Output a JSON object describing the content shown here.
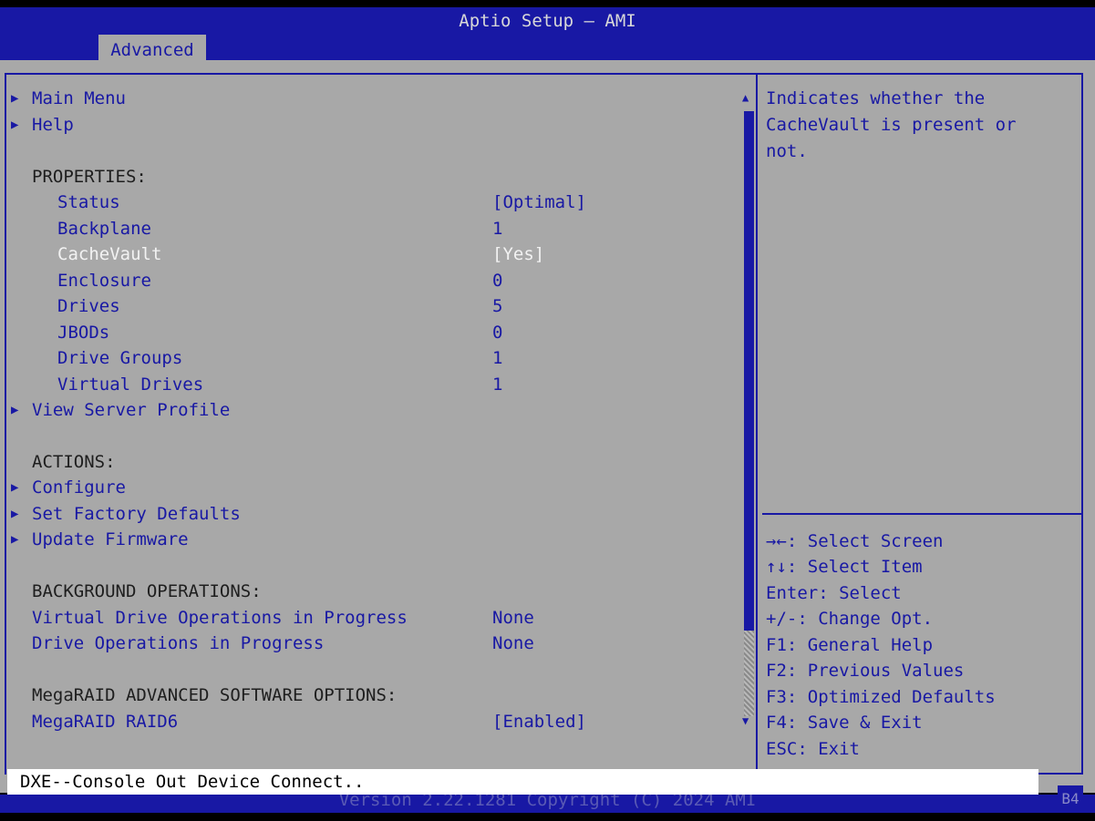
{
  "window": {
    "title": "Aptio Setup – AMI",
    "active_tab": "Advanced"
  },
  "menu": {
    "main_menu": "Main Menu",
    "help": "Help",
    "properties_header": "PROPERTIES:",
    "status_label": "Status",
    "status_value": "[Optimal]",
    "backplane_label": "Backplane",
    "backplane_value": "1",
    "cachevault_label": "CacheVault",
    "cachevault_value": "[Yes]",
    "enclosure_label": "Enclosure",
    "enclosure_value": "0",
    "drives_label": "Drives",
    "drives_value": "5",
    "jbods_label": "JBODs",
    "jbods_value": "0",
    "drive_groups_label": "Drive Groups",
    "drive_groups_value": "1",
    "virtual_drives_label": "Virtual Drives",
    "virtual_drives_value": "1",
    "view_server_profile": "View Server Profile",
    "actions_header": "ACTIONS:",
    "configure": "Configure",
    "set_factory_defaults": "Set Factory Defaults",
    "update_firmware": "Update Firmware",
    "bg_ops_header": "BACKGROUND OPERATIONS:",
    "vd_ops_label": "Virtual Drive Operations in Progress",
    "vd_ops_value": "None",
    "drive_ops_label": "Drive Operations in Progress",
    "drive_ops_value": "None",
    "megaraid_header": "MegaRAID ADVANCED SOFTWARE OPTIONS:",
    "raid6_label": "MegaRAID RAID6",
    "raid6_value": "[Enabled]"
  },
  "help_panel": {
    "line1": "Indicates whether the",
    "line2": "CacheVault is present or",
    "line3": "not."
  },
  "keys": [
    "→←: Select Screen",
    "↑↓: Select Item",
    "Enter: Select",
    "+/-: Change Opt.",
    "F1: General Help",
    "F2: Previous Values",
    "F3: Optimized Defaults",
    "F4: Save & Exit",
    "ESC: Exit"
  ],
  "status_line": "DXE--Console Out Device Connect..",
  "footer": {
    "version": "Version 2.22.1281 Copyright (C) 2024 AMI",
    "badge": "B4"
  },
  "colors": {
    "bios_blue": "#1818a4",
    "bios_gray": "#a8a8a8",
    "highlight": "#f2f2f2"
  },
  "icons": {
    "submenu": "triangle-right-icon",
    "scroll_up": "triangle-up-icon",
    "scroll_down": "triangle-down-icon"
  }
}
